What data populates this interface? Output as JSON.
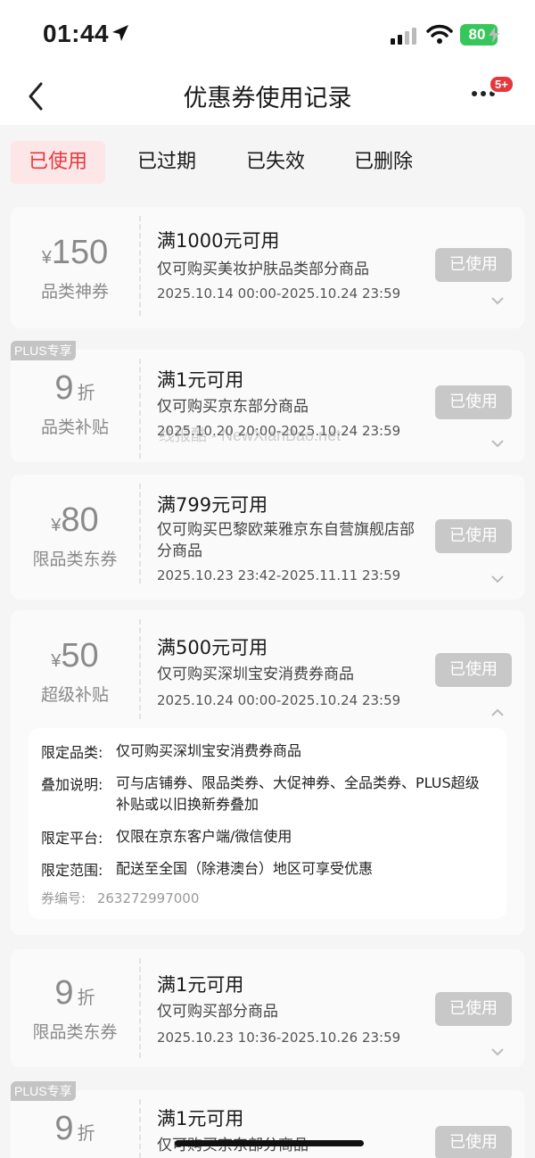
{
  "status_bar": {
    "time": "01:44",
    "battery": "80"
  },
  "nav": {
    "title": "优惠券使用记录",
    "badge": "5+"
  },
  "tabs": [
    {
      "label": "已使用",
      "active": true
    },
    {
      "label": "已过期",
      "active": false
    },
    {
      "label": "已失效",
      "active": false
    },
    {
      "label": "已删除",
      "active": false
    }
  ],
  "coupons": [
    {
      "currency": "¥",
      "amount": "150",
      "unit": "",
      "type": "品类神券",
      "plus_tag": "",
      "condition": "满1000元可用",
      "scope": "仅可购买美妆护肤品类部分商品",
      "period": "2025.10.14 00:00-2025.10.24 23:59",
      "status": "已使用"
    },
    {
      "currency": "",
      "amount": "9",
      "unit": "折",
      "type": "品类补贴",
      "plus_tag": "PLUS专享",
      "condition": "满1元可用",
      "scope": "仅可购买京东部分商品",
      "period": "2025.10.20 20:00-2025.10.24 23:59",
      "status": "已使用"
    },
    {
      "currency": "¥",
      "amount": "80",
      "unit": "",
      "type": "限品类东券",
      "plus_tag": "",
      "condition": "满799元可用",
      "scope": "仅可购买巴黎欧莱雅京东自营旗舰店部分商品",
      "period": "2025.10.23 23:42-2025.11.11 23:59",
      "status": "已使用"
    },
    {
      "currency": "¥",
      "amount": "50",
      "unit": "",
      "type": "超级补贴",
      "plus_tag": "",
      "condition": "满500元可用",
      "scope": "仅可购买深圳宝安消费券商品",
      "period": "2025.10.24 00:00-2025.10.24 23:59",
      "status": "已使用"
    },
    {
      "currency": "",
      "amount": "9",
      "unit": "折",
      "type": "限品类东券",
      "plus_tag": "",
      "condition": "满1元可用",
      "scope": "仅可购买部分商品",
      "period": "2025.10.23 10:36-2025.10.26 23:59",
      "status": "已使用"
    },
    {
      "currency": "",
      "amount": "9",
      "unit": "折",
      "type": "",
      "plus_tag": "PLUS专享",
      "condition": "满1元可用",
      "scope": "仅可购买京东部分商品",
      "period": "",
      "status": "已使用"
    }
  ],
  "detail": {
    "rows": [
      {
        "key": "限定品类:",
        "value": "仅可购买深圳宝安消费券商品"
      },
      {
        "key": "叠加说明:",
        "value": "可与店铺券、限品类券、大促神券、全品类券、PLUS超级补贴或以旧换新券叠加"
      },
      {
        "key": "限定平台:",
        "value": "仅限在京东客户端/微信使用"
      },
      {
        "key": "限定范围:",
        "value": "配送至全国（除港澳台）地区可享受优惠"
      }
    ],
    "code_label": "券编号:",
    "code": "263272997000"
  },
  "watermark": "线报酷 - NewXianBao.net"
}
